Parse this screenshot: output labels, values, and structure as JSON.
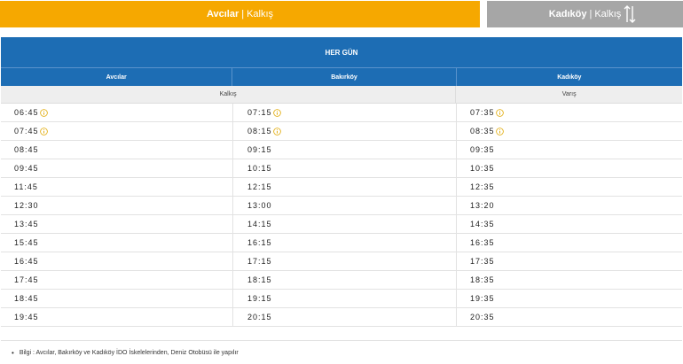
{
  "tabs": {
    "active": {
      "origin": "Avcılar",
      "separator": "|",
      "mode": "Kalkış"
    },
    "inactive": {
      "origin": "Kadıköy",
      "separator": "|",
      "mode": "Kalkış"
    }
  },
  "schedule": {
    "title": "HER GÜN",
    "columns": [
      "Avcılar",
      "Bakırköy",
      "Kadıköy"
    ],
    "departure_label": "Kalkış",
    "arrival_label": "Varış",
    "rows": [
      {
        "avcilar": "06:45",
        "bakirkoy": "07:15",
        "kadikoy": "07:35",
        "info": true
      },
      {
        "avcilar": "07:45",
        "bakirkoy": "08:15",
        "kadikoy": "08:35",
        "info": true
      },
      {
        "avcilar": "08:45",
        "bakirkoy": "09:15",
        "kadikoy": "09:35",
        "info": false
      },
      {
        "avcilar": "09:45",
        "bakirkoy": "10:15",
        "kadikoy": "10:35",
        "info": false
      },
      {
        "avcilar": "11:45",
        "bakirkoy": "12:15",
        "kadikoy": "12:35",
        "info": false
      },
      {
        "avcilar": "12:30",
        "bakirkoy": "13:00",
        "kadikoy": "13:20",
        "info": false
      },
      {
        "avcilar": "13:45",
        "bakirkoy": "14:15",
        "kadikoy": "14:35",
        "info": false
      },
      {
        "avcilar": "15:45",
        "bakirkoy": "16:15",
        "kadikoy": "16:35",
        "info": false
      },
      {
        "avcilar": "16:45",
        "bakirkoy": "17:15",
        "kadikoy": "17:35",
        "info": false
      },
      {
        "avcilar": "17:45",
        "bakirkoy": "18:15",
        "kadikoy": "18:35",
        "info": false
      },
      {
        "avcilar": "18:45",
        "bakirkoy": "19:15",
        "kadikoy": "19:35",
        "info": false
      },
      {
        "avcilar": "19:45",
        "bakirkoy": "20:15",
        "kadikoy": "20:35",
        "info": false
      }
    ]
  },
  "info": {
    "text": "Bilgi : Avcılar, Bakırköy ve Kadıköy İDO İskelelerinden, Deniz Otobüsü ile yapılır"
  },
  "icons": {
    "swap": "swap-arrows-icon",
    "info": "info-circle-icon"
  },
  "colors": {
    "active_tab": "#f6a800",
    "inactive_tab": "#a6a6a6",
    "header_blue": "#1d6db4",
    "info_icon": "#e0a800"
  }
}
